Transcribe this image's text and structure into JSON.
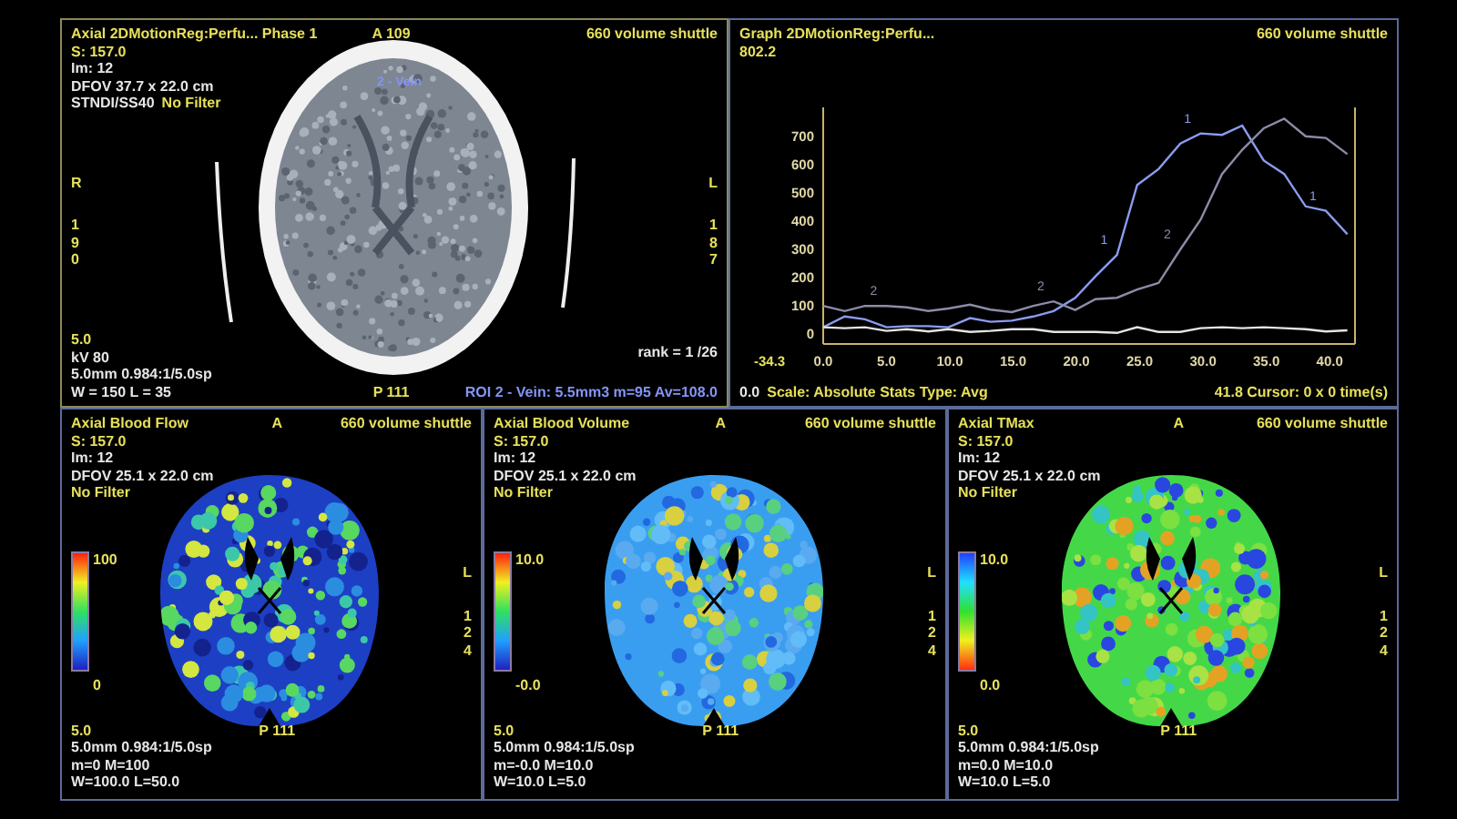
{
  "ct_panel": {
    "title_lines": [
      [
        {
          "text": "Axial 2DMotionReg:Perfu... Phase 1",
          "kind": "heading"
        }
      ],
      [
        {
          "text": "S: 157.0",
          "kind": "heading"
        }
      ],
      [
        {
          "text": "Im: 12",
          "kind": "info"
        }
      ],
      [
        {
          "text": "DFOV 37.7 x 22.0 cm",
          "kind": "info"
        }
      ],
      [
        {
          "text": "STNDI/SS40",
          "kind": "info"
        },
        {
          "text": "No Filter",
          "kind": "heading"
        }
      ]
    ],
    "top_center": "A 109",
    "top_right": "660 volume shuttle",
    "roi_label": "2 - Vein",
    "left_markers": [
      "R",
      "1",
      "9",
      "0"
    ],
    "right_markers": [
      "L",
      "1",
      "8",
      "7"
    ],
    "bottom_left_lines": [
      [
        {
          "text": "5.0",
          "kind": "heading"
        }
      ],
      [
        {
          "text": "kV 80",
          "kind": "info"
        }
      ],
      [
        {
          "text": "5.0mm 0.984:1/5.0sp",
          "kind": "info"
        }
      ],
      [
        {
          "text": "W = 150 L = 35",
          "kind": "info"
        }
      ]
    ],
    "bottom_center": "P 111",
    "bottom_right_lines": [
      [
        {
          "text": "rank = 1 /26",
          "kind": "info"
        }
      ],
      [
        {
          "text": "ROI 2 - Vein: 5.5mm3 m=95 Av=108.0",
          "kind": "roi"
        }
      ]
    ]
  },
  "graph_panel": {
    "title_lines": [
      [
        {
          "text": "Graph 2DMotionReg:Perfu...",
          "kind": "heading"
        }
      ],
      [
        {
          "text": "802.2",
          "kind": "heading"
        }
      ]
    ],
    "top_right": "660 volume shuttle",
    "y_min_text": "-34.3",
    "footer_left": [
      {
        "text": "0.0",
        "kind": "info"
      },
      {
        "text": "Scale: Absolute Stats Type: Avg",
        "kind": "heading"
      }
    ],
    "footer_right": [
      {
        "text": "41.8 Cursor: 0 x 0 time(s)",
        "kind": "heading"
      }
    ],
    "chart_data": {
      "type": "line",
      "x": [
        0,
        1.7,
        3.3,
        5.0,
        6.6,
        8.3,
        9.9,
        11.6,
        13.2,
        14.9,
        16.6,
        18.2,
        19.9,
        21.5,
        23.2,
        24.8,
        26.5,
        28.2,
        29.8,
        31.5,
        33.1,
        34.8,
        36.4,
        38.1,
        39.7,
        41.4
      ],
      "series": [
        {
          "name": "1",
          "color": "#8a9cf0",
          "values": [
            25,
            63,
            53,
            25,
            29,
            29,
            25,
            57,
            44,
            48,
            63,
            82,
            129,
            205,
            281,
            528,
            585,
            675,
            710,
            705,
            738,
            614,
            567,
            452,
            437,
            354
          ]
        },
        {
          "name": "2",
          "color": "#8c8ca8",
          "values": [
            100,
            82,
            100,
            100,
            95,
            82,
            91,
            105,
            87,
            78,
            100,
            116,
            86,
            124,
            129,
            158,
            182,
            300,
            405,
            567,
            652,
            728,
            762,
            700,
            694,
            637
          ]
        },
        {
          "color": "#e4e4e4",
          "values": [
            25,
            22,
            25,
            12,
            18,
            10,
            18,
            8,
            12,
            18,
            18,
            8,
            8,
            8,
            5,
            25,
            8,
            8,
            22,
            25,
            22,
            25,
            22,
            18,
            10,
            14
          ]
        }
      ],
      "xlim": [
        0,
        42
      ],
      "ylim": [
        -34.3,
        802.2
      ],
      "xticks": [
        {
          "value": 0,
          "label": "0.0"
        },
        {
          "value": 5,
          "label": "5.0"
        },
        {
          "value": 10,
          "label": "10.0"
        },
        {
          "value": 15,
          "label": "15.0"
        },
        {
          "value": 20,
          "label": "20.0"
        },
        {
          "value": 25,
          "label": "25.0"
        },
        {
          "value": 30,
          "label": "30.0"
        },
        {
          "value": 35,
          "label": "35.0"
        },
        {
          "value": 40,
          "label": "40.0"
        }
      ],
      "yticks": [
        0,
        100,
        200,
        300,
        400,
        500,
        600,
        700
      ]
    }
  },
  "map_panels": [
    {
      "kind": "flow",
      "title_lines": [
        [
          {
            "text": "Axial Blood Flow",
            "kind": "heading"
          }
        ],
        [
          {
            "text": "S: 157.0",
            "kind": "heading"
          }
        ],
        [
          {
            "text": "Im: 12",
            "kind": "info"
          }
        ],
        [
          {
            "text": "DFOV 25.1 x 22.0 cm",
            "kind": "info"
          }
        ],
        [
          {
            "text": "No Filter",
            "kind": "heading"
          }
        ]
      ],
      "top_center": "A",
      "top_right": "660 volume shuttle",
      "colorbar": {
        "kind": "rainbow",
        "max": "100",
        "min": "0"
      },
      "right_markers": [
        "L",
        "1",
        "2",
        "4"
      ],
      "bottom_left_lines": [
        [
          {
            "text": "5.0",
            "kind": "heading"
          }
        ],
        [
          {
            "text": "5.0mm 0.984:1/5.0sp",
            "kind": "info"
          }
        ],
        [
          {
            "text": "m=0 M=100",
            "kind": "info"
          }
        ],
        [
          {
            "text": "W=100.0 L=50.0",
            "kind": "info"
          }
        ]
      ],
      "bottom_center": "P 111"
    },
    {
      "kind": "volume",
      "title_lines": [
        [
          {
            "text": "Axial Blood Volume",
            "kind": "heading"
          }
        ],
        [
          {
            "text": "S: 157.0",
            "kind": "heading"
          }
        ],
        [
          {
            "text": "Im: 12",
            "kind": "info"
          }
        ],
        [
          {
            "text": "DFOV 25.1 x 22.0 cm",
            "kind": "info"
          }
        ],
        [
          {
            "text": "No Filter",
            "kind": "heading"
          }
        ]
      ],
      "top_center": "A",
      "top_right": "660 volume shuttle",
      "colorbar": {
        "kind": "rainbow",
        "max": "10.0",
        "min": "-0.0"
      },
      "right_markers": [
        "L",
        "1",
        "2",
        "4"
      ],
      "bottom_left_lines": [
        [
          {
            "text": "5.0",
            "kind": "heading"
          }
        ],
        [
          {
            "text": "5.0mm 0.984:1/5.0sp",
            "kind": "info"
          }
        ],
        [
          {
            "text": "m=-0.0 M=10.0",
            "kind": "info"
          }
        ],
        [
          {
            "text": "W=10.0 L=5.0",
            "kind": "info"
          }
        ]
      ],
      "bottom_center": "P 111"
    },
    {
      "kind": "tmax",
      "title_lines": [
        [
          {
            "text": "Axial TMax",
            "kind": "heading"
          }
        ],
        [
          {
            "text": "S: 157.0",
            "kind": "heading"
          }
        ],
        [
          {
            "text": "Im: 12",
            "kind": "info"
          }
        ],
        [
          {
            "text": "DFOV 25.1 x 22.0 cm",
            "kind": "info"
          }
        ],
        [
          {
            "text": "No Filter",
            "kind": "heading"
          }
        ]
      ],
      "top_center": "A",
      "top_right": "660 volume shuttle",
      "colorbar": {
        "kind": "reversed",
        "max": "10.0",
        "min": "0.0"
      },
      "right_markers": [
        "L",
        "1",
        "2",
        "4"
      ],
      "bottom_left_lines": [
        [
          {
            "text": "5.0",
            "kind": "heading"
          }
        ],
        [
          {
            "text": "5.0mm 0.984:1/5.0sp",
            "kind": "info"
          }
        ],
        [
          {
            "text": "m=0.0 M=10.0",
            "kind": "info"
          }
        ],
        [
          {
            "text": "W=10.0 L=5.0",
            "kind": "info"
          }
        ]
      ],
      "bottom_center": "P 111"
    }
  ]
}
